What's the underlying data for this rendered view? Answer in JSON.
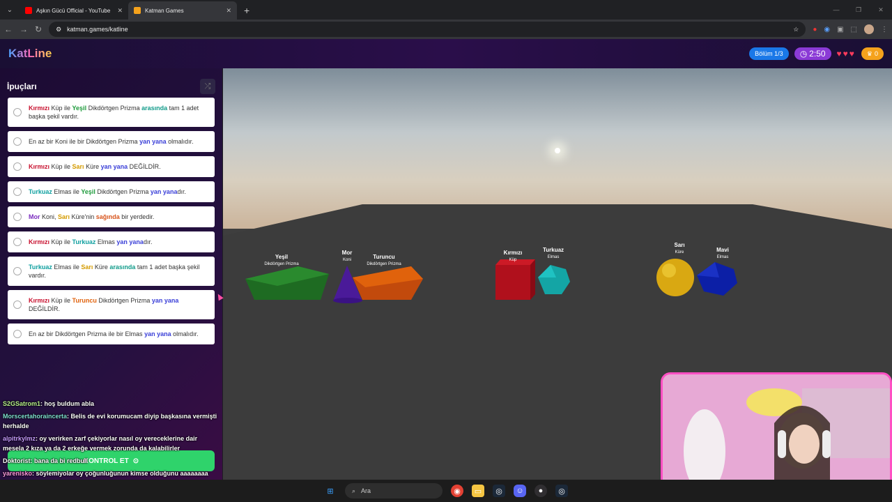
{
  "browser": {
    "tabs": [
      {
        "title": "Aşkın Gücü Official - YouTube",
        "favicon_color": "#ff0000",
        "active": false
      },
      {
        "title": "Katman Games",
        "favicon_color": "#f5a21c",
        "active": true
      }
    ],
    "new_tab_label": "+",
    "url": "katman.games/katline"
  },
  "app": {
    "logo": "KatLine",
    "level": "Bölüm 1/3",
    "timer": "2:50",
    "hearts": "♥♥♥",
    "score": "0"
  },
  "sidebar": {
    "title": "İpuçları",
    "hints": [
      {
        "parts": [
          {
            "t": "Kırmızı",
            "c": "c-red"
          },
          {
            "t": " Küp ile "
          },
          {
            "t": "Yeşil",
            "c": "c-green"
          },
          {
            "t": " Dikdörtgen Prizma "
          },
          {
            "t": "arasında",
            "c": "c-relteal"
          },
          {
            "t": " tam 1 adet başka şekil vardır."
          }
        ],
        "h": 42
      },
      {
        "parts": [
          {
            "t": "En az bir Koni ile bir Dikdörtgen Prizma "
          },
          {
            "t": "yan yana",
            "c": "c-rel"
          },
          {
            "t": " olmalıdır."
          }
        ],
        "h": 30
      },
      {
        "parts": [
          {
            "t": "Kırmızı",
            "c": "c-red"
          },
          {
            "t": " Küp ile "
          },
          {
            "t": "Sarı",
            "c": "c-yellow"
          },
          {
            "t": " Küre "
          },
          {
            "t": "yan yana",
            "c": "c-rel"
          },
          {
            "t": " DEĞİLDİR."
          }
        ],
        "h": 30
      },
      {
        "parts": [
          {
            "t": "Turkuaz",
            "c": "c-teal"
          },
          {
            "t": " Elmas ile "
          },
          {
            "t": "Yeşil",
            "c": "c-green"
          },
          {
            "t": " Dikdörtgen Prizma "
          },
          {
            "t": "yan yana",
            "c": "c-rel"
          },
          {
            "t": "dır."
          }
        ],
        "h": 30
      },
      {
        "parts": [
          {
            "t": "Mor",
            "c": "c-purple"
          },
          {
            "t": " Koni, "
          },
          {
            "t": "Sarı",
            "c": "c-yellow"
          },
          {
            "t": " Küre'nin "
          },
          {
            "t": "sağında",
            "c": "c-relorange"
          },
          {
            "t": " bir yerdedir."
          }
        ],
        "h": 30
      },
      {
        "parts": [
          {
            "t": "Kırmızı",
            "c": "c-red"
          },
          {
            "t": " Küp ile "
          },
          {
            "t": "Turkuaz",
            "c": "c-teal"
          },
          {
            "t": " Elmas "
          },
          {
            "t": "yan yana",
            "c": "c-rel"
          },
          {
            "t": "dır."
          }
        ],
        "h": 30
      },
      {
        "parts": [
          {
            "t": "Turkuaz",
            "c": "c-teal"
          },
          {
            "t": " Elmas ile "
          },
          {
            "t": "Sarı",
            "c": "c-yellow"
          },
          {
            "t": " Küre "
          },
          {
            "t": "arasında",
            "c": "c-relteal"
          },
          {
            "t": " tam 1 adet başka şekil vardır."
          }
        ],
        "h": 42
      },
      {
        "parts": [
          {
            "t": "Kırmızı",
            "c": "c-red"
          },
          {
            "t": " Küp ile "
          },
          {
            "t": "Turuncu",
            "c": "c-orange"
          },
          {
            "t": " Dikdörtgen Prizma "
          },
          {
            "t": "yan yana",
            "c": "c-rel"
          },
          {
            "t": " DEĞİLDİR."
          }
        ],
        "h": 42
      },
      {
        "parts": [
          {
            "t": "En az bir Dikdörtgen Prizma ile bir Elmas "
          },
          {
            "t": "yan yana",
            "c": "c-rel"
          },
          {
            "t": " olmalıdır."
          }
        ],
        "h": 30
      }
    ],
    "control_button": "KONTROL ET"
  },
  "chat": [
    {
      "user": "S2GSatrom1",
      "color": "#b6f08a",
      "text": ": hoş buldum abla"
    },
    {
      "user": "Morscertahoraincerta",
      "color": "#7fe0d0",
      "text": ": Belis de evi korumucam diyip başkasına vermişti herhalde"
    },
    {
      "user": "alpitrkylmz",
      "color": "#c79bff",
      "text": ": oy verirken zarf çekiyorlar nasıl oy vereceklerine dair mesela 2 kıza ya da 2 erkeğe vermek zorunda da kalabilirler"
    },
    {
      "user": "Doktorist",
      "color": "#ffffff",
      "text": ": bana da bi redbull"
    },
    {
      "user": "yarenisko",
      "color": "#ff9de0",
      "text": ": söylemiyolar oy çoğunluğunun kimse olduğunu aaaaaaaa"
    }
  ],
  "scene": {
    "objects": [
      {
        "name": "Yeşil",
        "shape": "Dikdörtgen Prizma",
        "color": "#1e6b22"
      },
      {
        "name": "Mor",
        "shape": "Koni",
        "color": "#4a1a99"
      },
      {
        "name": "Turuncu",
        "shape": "Dikdörtgen Prizma",
        "color": "#d6500e"
      },
      {
        "name": "Kırmızı",
        "shape": "Küp",
        "color": "#b0101c"
      },
      {
        "name": "Turkuaz",
        "shape": "Elmas",
        "color": "#14a5a5"
      },
      {
        "name": "Sarı",
        "shape": "Küre",
        "color": "#e0b21a"
      },
      {
        "name": "Mavi",
        "shape": "Elmas",
        "color": "#0c1fa6"
      }
    ]
  },
  "taskbar": {
    "search_placeholder": "Ara",
    "apps": [
      "windows-start-icon",
      "chrome-icon",
      "file-explorer-icon",
      "steam-icon",
      "discord-icon",
      "obs-icon",
      "steam-alt-icon"
    ]
  }
}
